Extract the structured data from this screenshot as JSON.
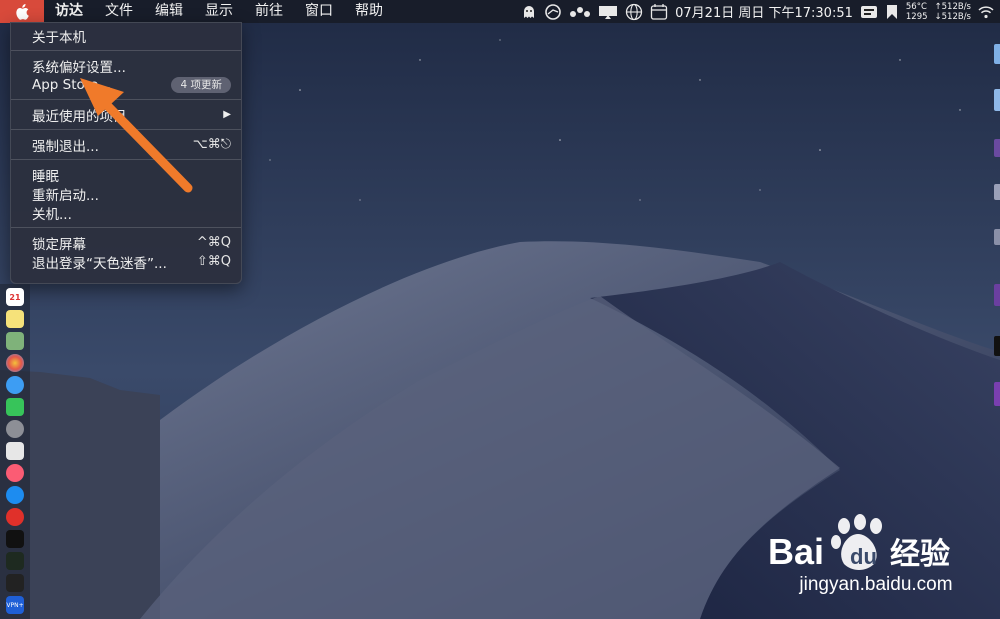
{
  "menubar": {
    "apple_icon": "apple-logo-icon",
    "items": [
      {
        "label": "访达"
      },
      {
        "label": "文件"
      },
      {
        "label": "编辑"
      },
      {
        "label": "显示"
      },
      {
        "label": "前往"
      },
      {
        "label": "窗口"
      },
      {
        "label": "帮助"
      }
    ],
    "status": {
      "datetime": "07月21日 周日 下午17:30:51",
      "temp": "56°C",
      "fan": "1295",
      "upload": "↑512B/s",
      "download": "↓512B/s",
      "icons": [
        "ghost-icon",
        "sync-icon",
        "dots-icon",
        "display-icon",
        "globe-icon",
        "calendar-icon",
        "input-method-icon",
        "bookmark-icon",
        "wifi-icon"
      ]
    }
  },
  "apple_menu": {
    "about": "关于本机",
    "system_prefs": "系统偏好设置...",
    "app_store": "App Store...",
    "app_store_badge": "4 项更新",
    "recent_items": "最近使用的项目",
    "force_quit": "强制退出...",
    "force_quit_shortcut": "⌥⌘⎋",
    "sleep": "睡眠",
    "restart": "重新启动...",
    "shutdown": "关机...",
    "lock_screen": "锁定屏幕",
    "lock_shortcut": "^⌘Q",
    "logout": "退出登录“天色迷香”...",
    "logout_shortcut": "⇧⌘Q"
  },
  "dock": {
    "calendar_day": "21",
    "vpn_label": "VPN+"
  },
  "watermark": {
    "brand": "Bai du 经验",
    "url": "jingyan.baidu.com"
  },
  "colors": {
    "apple_button": "#d84a3b",
    "arrow": "#f07a2a"
  }
}
